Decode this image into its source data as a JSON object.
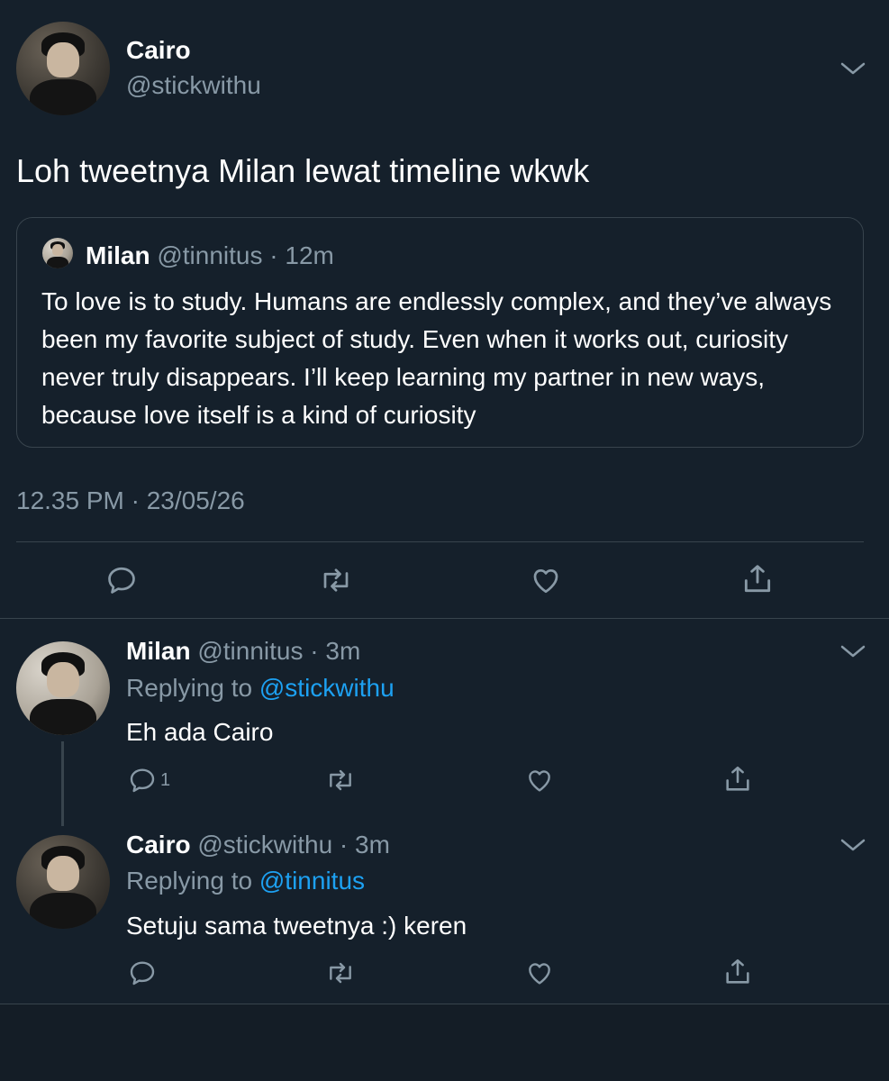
{
  "main_tweet": {
    "name": "Cairo",
    "handle": "@stickwithu",
    "text": "Loh tweetnya Milan lewat timeline wkwk",
    "quoted": {
      "name": "Milan",
      "handle": "@tinnitus",
      "sep": " · ",
      "time": "12m",
      "text": "To love is to study. Humans are endlessly complex, and they’ve always been my favorite subject of study. Even when it works out, curiosity never truly disappears. I’ll keep learning my partner in new ways, because love itself is a kind of curiosity"
    },
    "timestamp": "12.35 PM · 23/05/26",
    "actions": [
      "reply-icon",
      "retweet-icon",
      "like-icon",
      "share-icon"
    ]
  },
  "replies": [
    {
      "name": "Milan",
      "handle": "@tinnitus",
      "sep": " · ",
      "time": "3m",
      "replying_prefix": "Replying to ",
      "replying_to": "@stickwithu",
      "text": "Eh ada Cairo",
      "reply_count": "1"
    },
    {
      "name": "Cairo",
      "handle": "@stickwithu",
      "sep": " · ",
      "time": "3m",
      "replying_prefix": "Replying to ",
      "replying_to": "@tinnitus",
      "text": "Setuju sama tweetnya :) keren"
    }
  ],
  "colors": {
    "background": "#15202b",
    "secondary_text": "#8899a6",
    "link": "#1da1f2",
    "border": "#38444d"
  }
}
